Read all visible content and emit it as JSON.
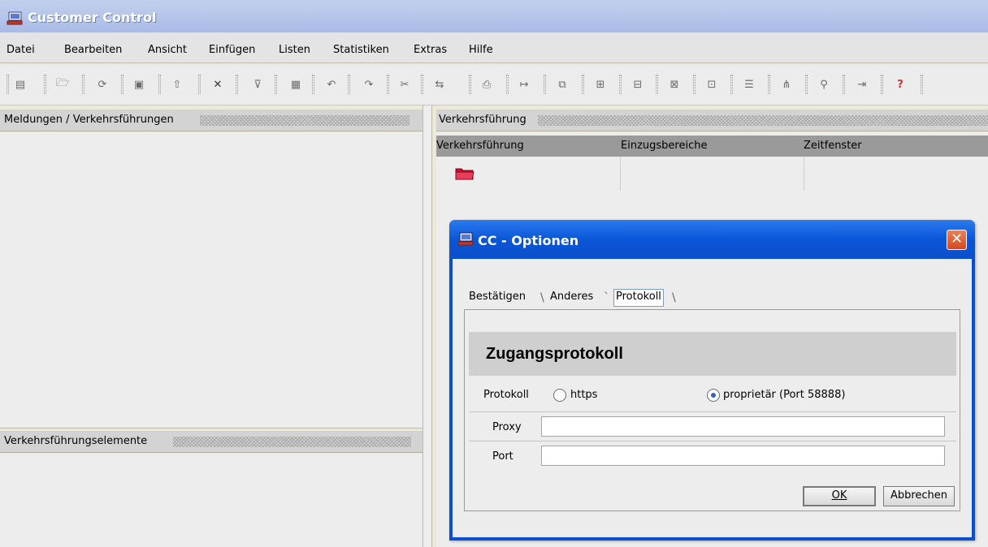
{
  "app": {
    "title": "Customer Control"
  },
  "menu": [
    "Datei",
    "Bearbeiten",
    "Ansicht",
    "Einfügen",
    "Listen",
    "Statistiken",
    "Extras",
    "Hilfe"
  ],
  "toolbar_icons": [
    "new-icon",
    "open-folder-icon",
    "refresh-icon",
    "save-icon",
    "export-icon",
    "delete-icon",
    "filter-icon",
    "properties-icon",
    "undo-icon",
    "redo-icon",
    "cut-icon",
    "copy-move-icon",
    "print-icon",
    "route-icon",
    "link-icon",
    "tree-icon",
    "tree-branch-icon",
    "tree-expand-icon",
    "tree-collapse-icon",
    "list-icon",
    "hierarchy-icon",
    "find-icon",
    "import-icon",
    "help-icon"
  ],
  "panes": {
    "left_top": {
      "title": "Meldungen / Verkehrsführungen"
    },
    "left_bottom": {
      "title": "Verkehrsführungselemente"
    },
    "right": {
      "title": "Verkehrsführung",
      "columns": [
        "Verkehrsführung",
        "Einzugsbereiche",
        "Zeitfenster"
      ]
    }
  },
  "dialog": {
    "title": "CC - Optionen",
    "close_symbol": "✕",
    "tabs": [
      "Bestätigen",
      "Anderes",
      "Protokoll"
    ],
    "active_tab": "Protokoll",
    "section_title": "Zugangsprotokoll",
    "protocol": {
      "label": "Protokoll",
      "options": [
        "https",
        "proprietär (Port 58888)"
      ],
      "selected": "proprietär (Port 58888)"
    },
    "proxy": {
      "label": "Proxy",
      "value": ""
    },
    "port": {
      "label": "Port",
      "value": ""
    },
    "buttons": {
      "ok": "OK",
      "cancel": "Abbrechen"
    }
  }
}
